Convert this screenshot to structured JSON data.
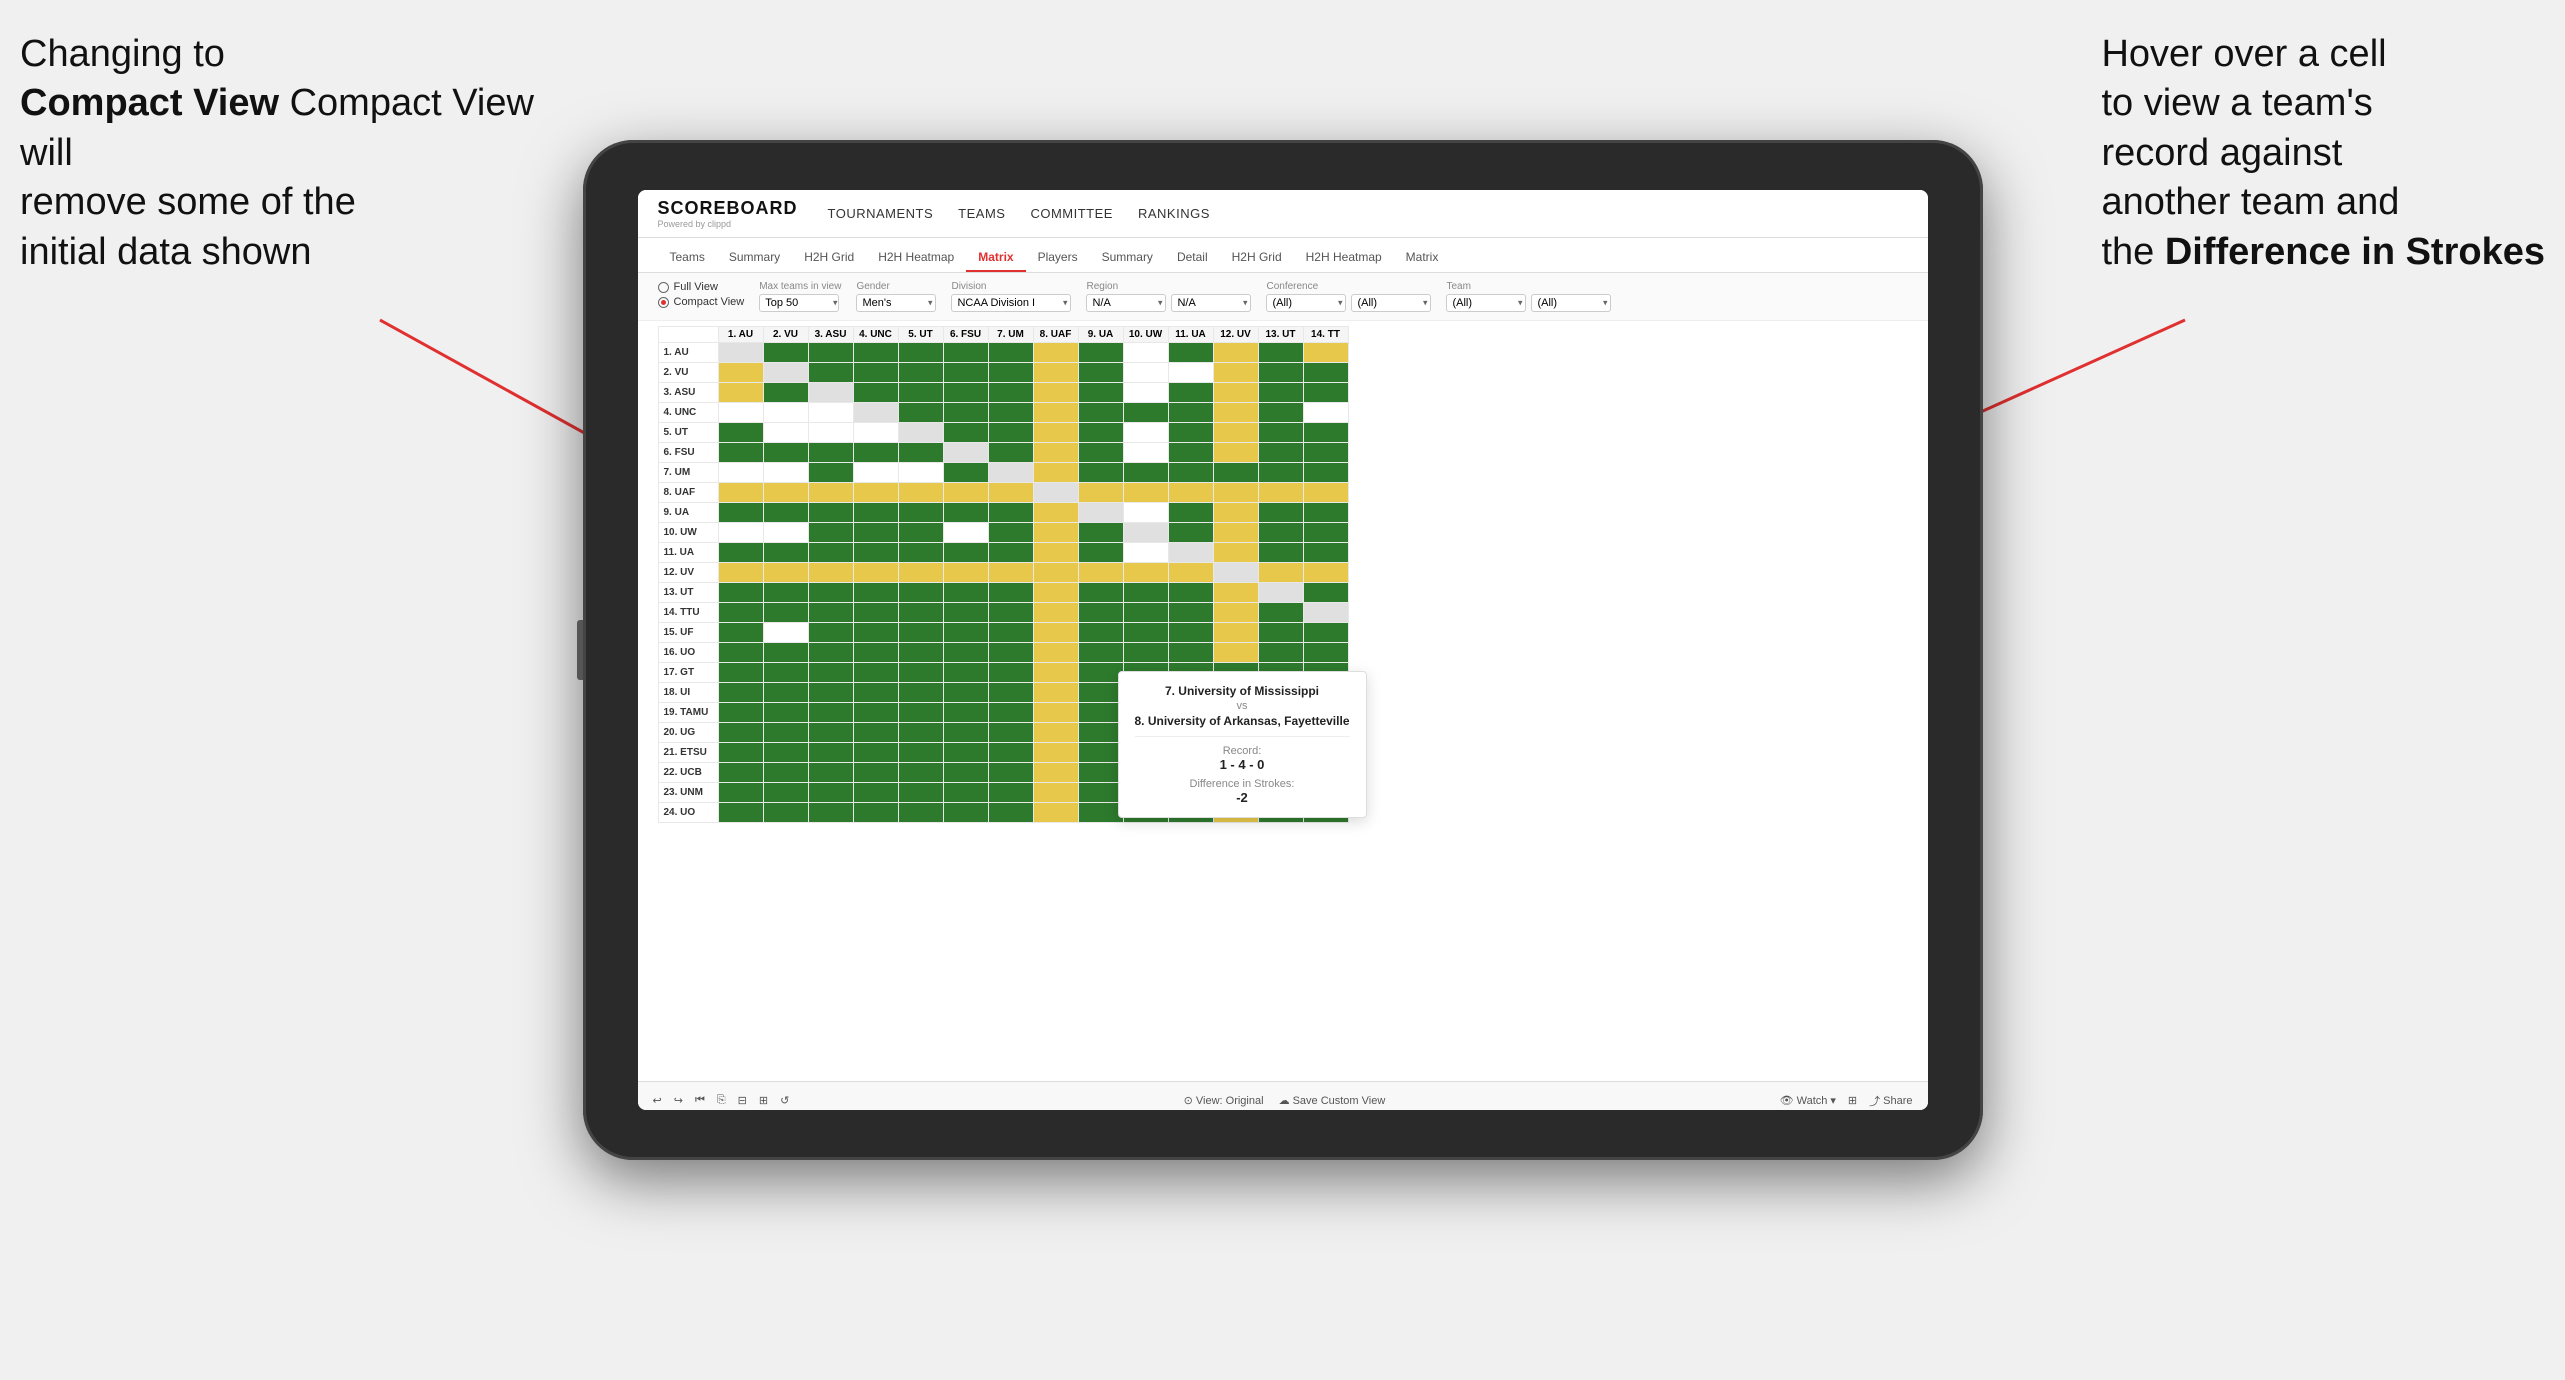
{
  "annotations": {
    "left": {
      "line1": "Changing to",
      "line2": "Compact View will",
      "line3": "remove some of the",
      "line4": "initial data shown"
    },
    "right": {
      "line1": "Hover over a cell",
      "line2": "to view a team's",
      "line3": "record against",
      "line4": "another team and",
      "line5": "the",
      "bold": "Difference in Strokes"
    }
  },
  "navbar": {
    "logo": "SCOREBOARD",
    "logo_sub": "Powered by clippd",
    "links": [
      "TOURNAMENTS",
      "TEAMS",
      "COMMITTEE",
      "RANKINGS"
    ]
  },
  "sub_nav": {
    "tabs": [
      "Teams",
      "Summary",
      "H2H Grid",
      "H2H Heatmap",
      "Matrix",
      "Players",
      "Summary",
      "Detail",
      "H2H Grid",
      "H2H Heatmap",
      "Matrix"
    ],
    "active": "Matrix"
  },
  "controls": {
    "view_full": "Full View",
    "view_compact": "Compact View",
    "filters": {
      "max_teams": {
        "label": "Max teams in view",
        "value": "Top 50"
      },
      "gender": {
        "label": "Gender",
        "value": "Men's"
      },
      "division": {
        "label": "Division",
        "value": "NCAA Division I"
      },
      "region": {
        "label": "Region",
        "value": "N/A"
      },
      "conference": {
        "label": "Conference",
        "value": "(All)"
      },
      "team": {
        "label": "Team",
        "value": "(All)"
      }
    }
  },
  "col_headers": [
    "1. AU",
    "2. VU",
    "3. ASU",
    "4. UNC",
    "5. UT",
    "6. FSU",
    "7. UM",
    "8. UAF",
    "9. UA",
    "10. UW",
    "11. UA",
    "12. UV",
    "13. UT",
    "14. TT"
  ],
  "row_labels": [
    "1. AU",
    "2. VU",
    "3. ASU",
    "4. UNC",
    "5. UT",
    "6. FSU",
    "7. UM",
    "8. UAF",
    "9. UA",
    "10. UW",
    "11. UA",
    "12. UV",
    "13. UT",
    "14. TTU",
    "15. UF",
    "16. UO",
    "17. GT",
    "18. UI",
    "19. TAMU",
    "20. UG",
    "21. ETSU",
    "22. UCB",
    "23. UNM",
    "24. UO"
  ],
  "tooltip": {
    "team1": "7. University of Mississippi",
    "vs": "vs",
    "team2": "8. University of Arkansas, Fayetteville",
    "record_label": "Record:",
    "record": "1 - 4 - 0",
    "strokes_label": "Difference in Strokes:",
    "strokes": "-2"
  },
  "toolbar": {
    "undo": "↩",
    "redo": "↪",
    "history": "⏮",
    "copy": "⎘",
    "zoom_out": "−",
    "zoom_in": "+",
    "refresh": "↺",
    "view_original": "View: Original",
    "save_custom": "Save Custom View",
    "watch": "Watch",
    "layout": "⊞",
    "share": "Share"
  }
}
